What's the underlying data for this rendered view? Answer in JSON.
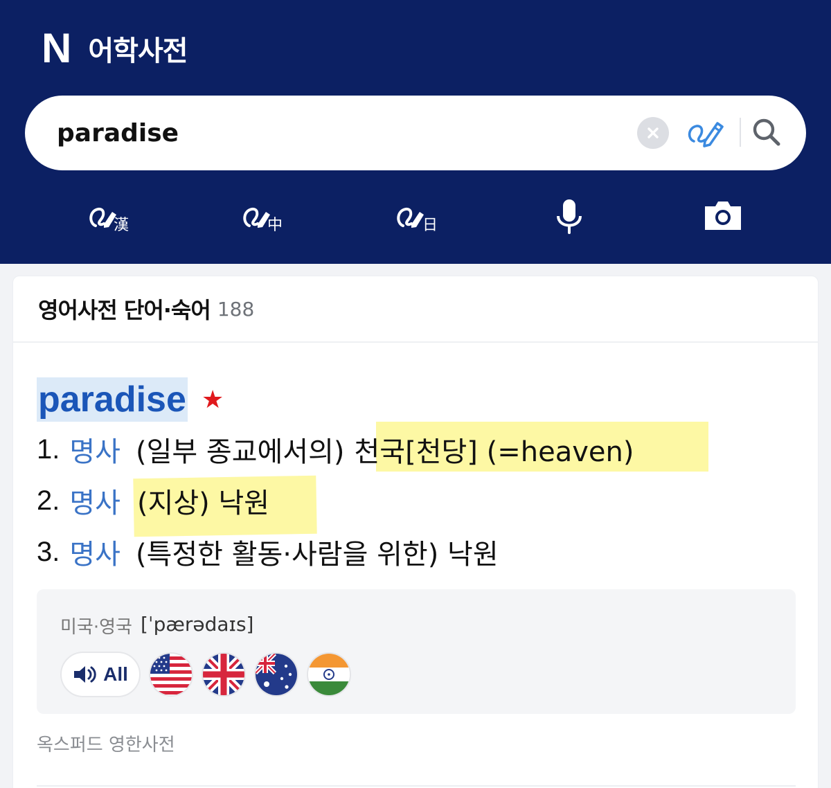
{
  "header": {
    "logo_letter": "N",
    "title": "어학사전"
  },
  "search": {
    "query": "paradise",
    "clear_icon": "x-circle-icon",
    "handwriting_icon": "handwriting-pen-icon",
    "search_icon": "magnifier-icon"
  },
  "tools": [
    {
      "name": "handwriting-hanja",
      "glyph": "漢"
    },
    {
      "name": "handwriting-chinese",
      "glyph": "中"
    },
    {
      "name": "handwriting-japanese",
      "glyph": "日"
    },
    {
      "name": "voice-search",
      "icon": "microphone-icon"
    },
    {
      "name": "image-search",
      "icon": "camera-icon"
    }
  ],
  "section": {
    "title": "영어사전 단어·숙어",
    "count": "188"
  },
  "entry": {
    "word": "paradise",
    "star_icon": "star-icon",
    "senses": [
      {
        "num": "1.",
        "pos": "명사",
        "note": "(일부 종교에서의)",
        "meaning": "천국[천당] (=heaven)"
      },
      {
        "num": "2.",
        "pos": "명사",
        "note": "",
        "meaning": "(지상) 낙원"
      },
      {
        "num": "3.",
        "pos": "명사",
        "note": "(특정한 활동·사람을 위한) 낙원",
        "meaning": ""
      }
    ]
  },
  "pronunciation": {
    "region": "미국·영국",
    "ipa": "[ˈpærədaɪs]",
    "all_label": "All",
    "flags": [
      "us-flag-icon",
      "uk-flag-icon",
      "australia-flag-icon",
      "india-flag-icon"
    ]
  },
  "source": "옥스퍼드 영한사전",
  "colors": {
    "header_bg": "#0c2063",
    "link_blue": "#1b56b8",
    "pos_blue": "#3a73c6",
    "highlight": "#fdf8a4",
    "star": "#e0191d"
  }
}
